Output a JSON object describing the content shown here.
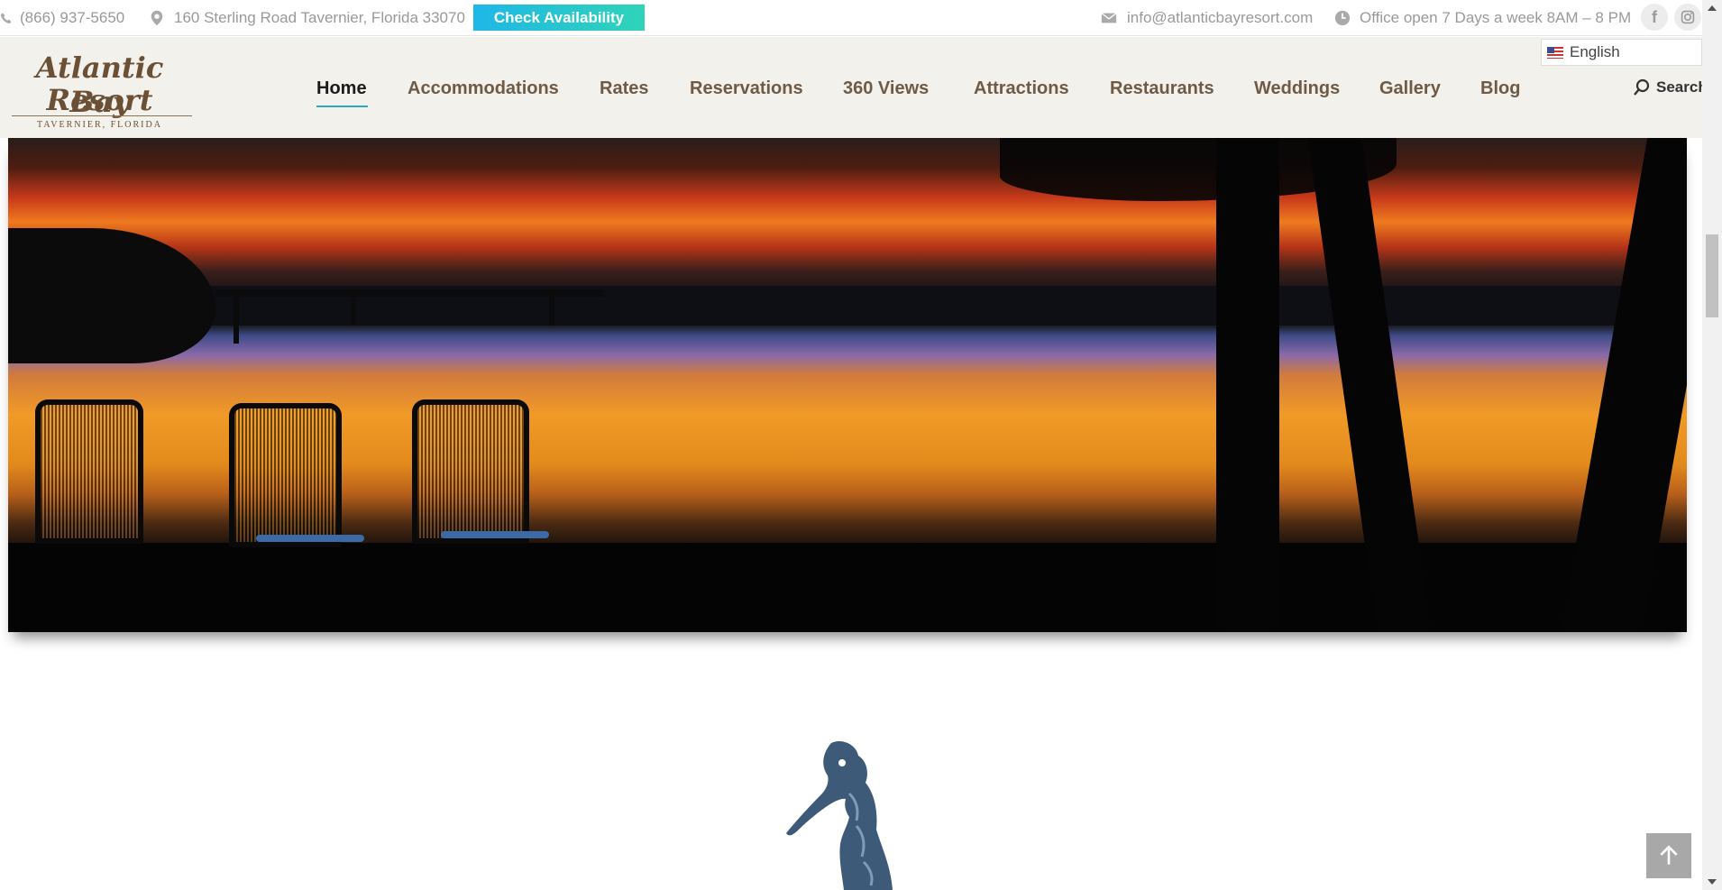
{
  "topbar": {
    "phone": "(866) 937-5650",
    "address": "160 Sterling Road Tavernier, Florida 33070",
    "check_availability": "Check Availability",
    "email": "info@atlanticbayresort.com",
    "hours": "Office open 7 Days a week 8AM – 8 PM",
    "social": [
      "facebook",
      "instagram"
    ]
  },
  "logo": {
    "line1": "Atlantic Bay",
    "line2": "Resort",
    "tagline": "TAVERNIER, FLORIDA"
  },
  "nav": {
    "items": [
      "Home",
      "Accommodations",
      "Rates",
      "Reservations",
      "360 Views",
      "Attractions",
      "Restaurants",
      "Weddings",
      "Gallery",
      "Blog"
    ],
    "active": "Home",
    "search_label": "Search"
  },
  "language": {
    "selected": "English",
    "flag": "us-flag-icon"
  },
  "hero": {
    "subject": "sunset-over-bay-photo"
  },
  "colors": {
    "accent": "#2aa8c7",
    "nav_text": "#6e5a45",
    "header_bg": "#f3f1ec",
    "button_gradient_start": "#1fb7e7",
    "button_gradient_end": "#2fd4b7",
    "seahorse": "#3d5a78"
  }
}
